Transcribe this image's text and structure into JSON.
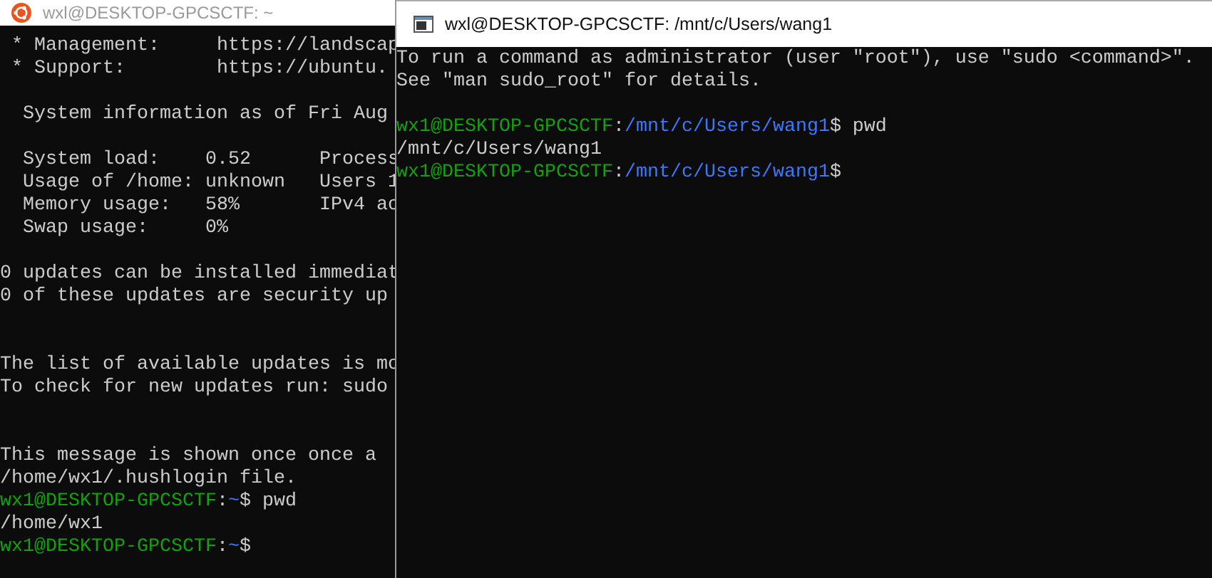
{
  "windows": [
    {
      "title": "wxl@DESKTOP-GPCSCTF: ~",
      "lines": [
        {
          "kind": "output",
          "text": " * Management:     https://landscap"
        },
        {
          "kind": "output",
          "text": " * Support:        https://ubuntu."
        },
        {
          "kind": "blank"
        },
        {
          "kind": "output",
          "text": "  System information as of Fri Aug"
        },
        {
          "kind": "blank"
        },
        {
          "kind": "output",
          "text": "  System load:    0.52      Process"
        },
        {
          "kind": "output",
          "text": "  Usage of /home: unknown   Users 1"
        },
        {
          "kind": "output",
          "text": "  Memory usage:   58%       IPv4 ac"
        },
        {
          "kind": "output",
          "text": "  Swap usage:     0%"
        },
        {
          "kind": "blank"
        },
        {
          "kind": "output",
          "text": "0 updates can be installed immediat"
        },
        {
          "kind": "output",
          "text": "0 of these updates are security up"
        },
        {
          "kind": "blank"
        },
        {
          "kind": "blank"
        },
        {
          "kind": "output",
          "text": "The list of available updates is mo"
        },
        {
          "kind": "output",
          "text": "To check for new updates run: sudo"
        },
        {
          "kind": "blank"
        },
        {
          "kind": "blank"
        },
        {
          "kind": "output",
          "text": "This message is shown once once a"
        },
        {
          "kind": "output",
          "text": "/home/wx1/.hushlogin file."
        },
        {
          "kind": "prompt",
          "user": "wx1@DESKTOP-GPCSCTF",
          "sep": ":",
          "path": "~",
          "tail": "$ pwd"
        },
        {
          "kind": "output",
          "text": "/home/wx1"
        },
        {
          "kind": "prompt",
          "user": "wx1@DESKTOP-GPCSCTF",
          "sep": ":",
          "path": "~",
          "tail": "$"
        }
      ]
    },
    {
      "title": "wxl@DESKTOP-GPCSCTF: /mnt/c/Users/wang1",
      "lines": [
        {
          "kind": "output",
          "text": "To run a command as administrator (user \"root\"), use \"sudo <command>\"."
        },
        {
          "kind": "output",
          "text": "See \"man sudo_root\" for details."
        },
        {
          "kind": "blank"
        },
        {
          "kind": "prompt",
          "user": "wx1@DESKTOP-GPCSCTF",
          "sep": ":",
          "path": "/mnt/c/Users/wang1",
          "tail": "$ pwd"
        },
        {
          "kind": "output",
          "text": "/mnt/c/Users/wang1"
        },
        {
          "kind": "prompt",
          "user": "wx1@DESKTOP-GPCSCTF",
          "sep": ":",
          "path": "/mnt/c/Users/wang1",
          "tail": "$"
        }
      ]
    }
  ]
}
